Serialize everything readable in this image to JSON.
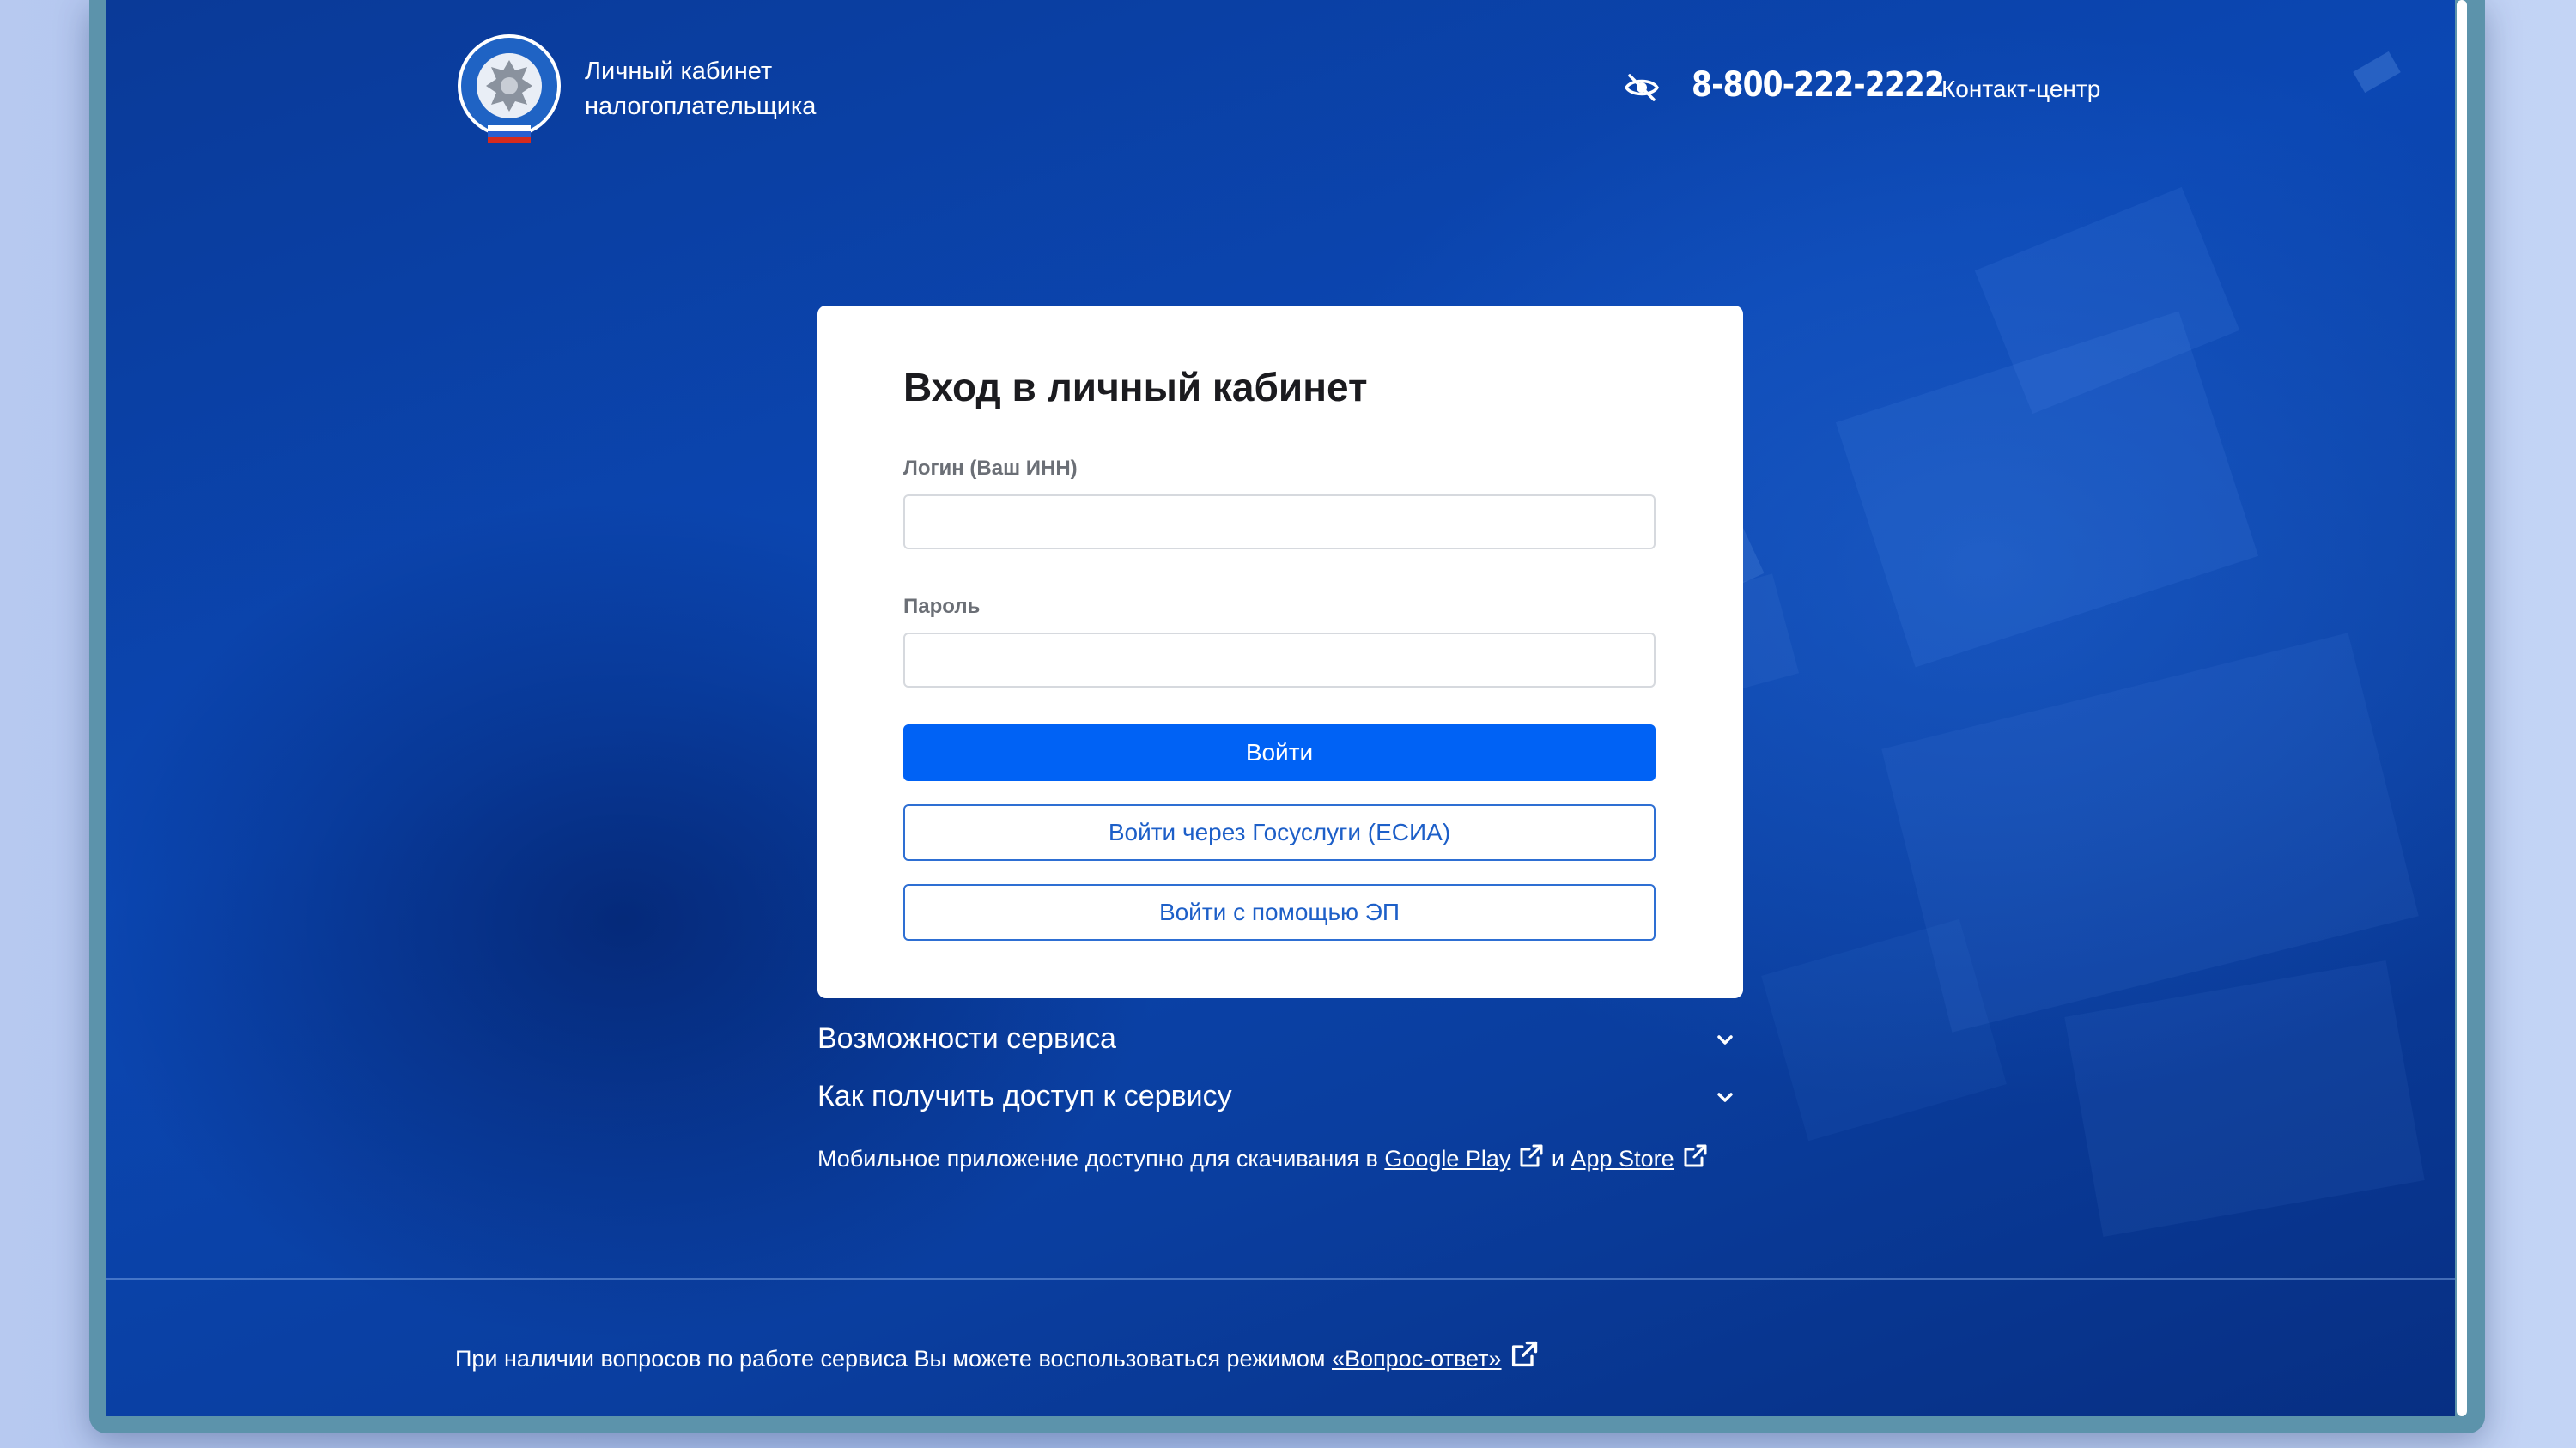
{
  "header": {
    "logo_line1": "Личный кабинет",
    "logo_line2": "налогоплательщика",
    "phone": "8-800-222-2222",
    "contact_label": "Контакт-центр"
  },
  "login_card": {
    "title": "Вход в личный кабинет",
    "login_label": "Логин (Ваш ИНН)",
    "login_value": "",
    "password_label": "Пароль",
    "password_value": "",
    "submit_label": "Войти",
    "gosuslugi_label": "Войти через Госуслуги (ЕСИА)",
    "ep_label": "Войти с помощью ЭП"
  },
  "accordion": [
    {
      "label": "Возможности сервиса"
    },
    {
      "label": "Как получить доступ к сервису"
    }
  ],
  "mobile": {
    "text": "Мобильное приложение доступно для скачивания в ",
    "google_play": "Google Play",
    "and": " и ",
    "app_store": "App Store"
  },
  "footer": {
    "text": "При наличии вопросов по работе сервиса Вы можете воспользоваться режимом ",
    "link": "«Вопрос-ответ»"
  },
  "colors": {
    "primary_button": "#0062f5",
    "background": "#0b47b3",
    "outline_button_text": "#1d5fc8"
  },
  "icons": [
    "fns-emblem-icon",
    "eye-slash-icon",
    "chevron-down-icon",
    "external-link-icon"
  ]
}
